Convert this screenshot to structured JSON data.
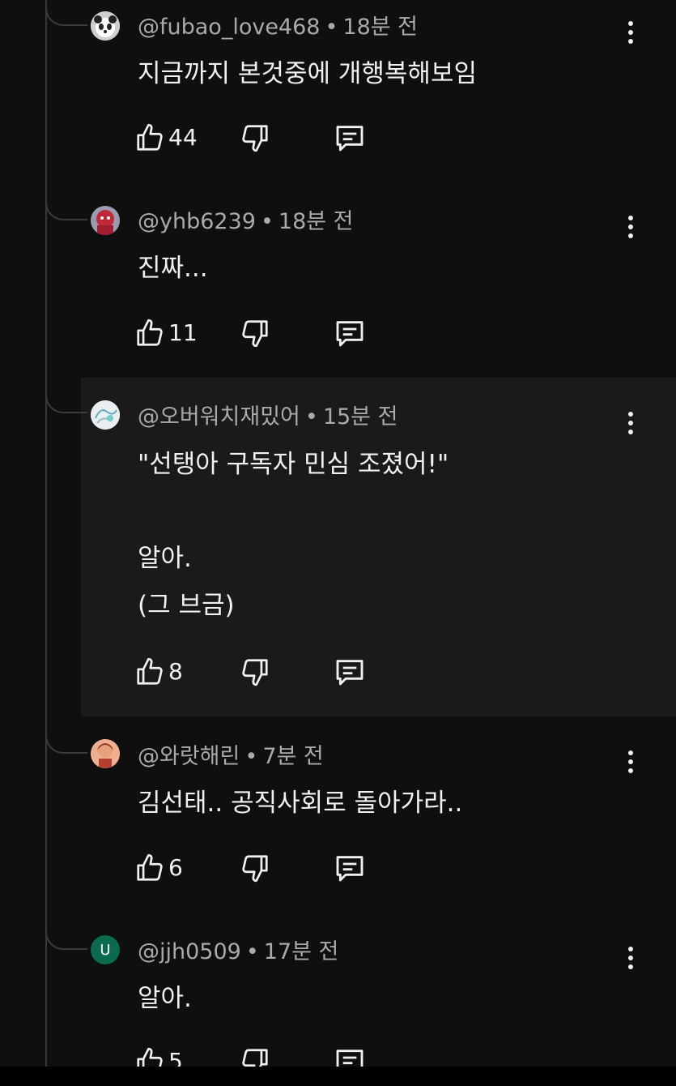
{
  "comments": [
    {
      "author": "@fubao_love468",
      "time": "18분 전",
      "text": "지금까지 본것중에 개행복해보임",
      "likes": "44",
      "avatar": "panda-avatar"
    },
    {
      "author": "@yhb6239",
      "time": "18분 전",
      "text": "진짜...",
      "likes": "11",
      "avatar": "red-character-avatar"
    },
    {
      "author": "@오버워치재밌어",
      "time": "15분 전",
      "text": "\"선탱아 구독자 민심 조졌어!\"\n\n알아.\n(그 브금)",
      "likes": "8",
      "avatar": "sketch-avatar"
    },
    {
      "author": "@와랏해린",
      "time": "7분 전",
      "text": "김선태.. 공직사회로 돌아가라..",
      "likes": "6",
      "avatar": "person-avatar"
    },
    {
      "author": "@jjh0509",
      "time": "17분 전",
      "text": "알아.",
      "likes": "5",
      "avatar": "letter-avatar",
      "avatar_letter": "U"
    }
  ],
  "colors": {
    "background": "#0f0f0f",
    "highlight": "#1a1a1a",
    "text": "#f1f1f1",
    "meta": "#aaaaaa",
    "letter_avatar": "#0b6b4f"
  }
}
